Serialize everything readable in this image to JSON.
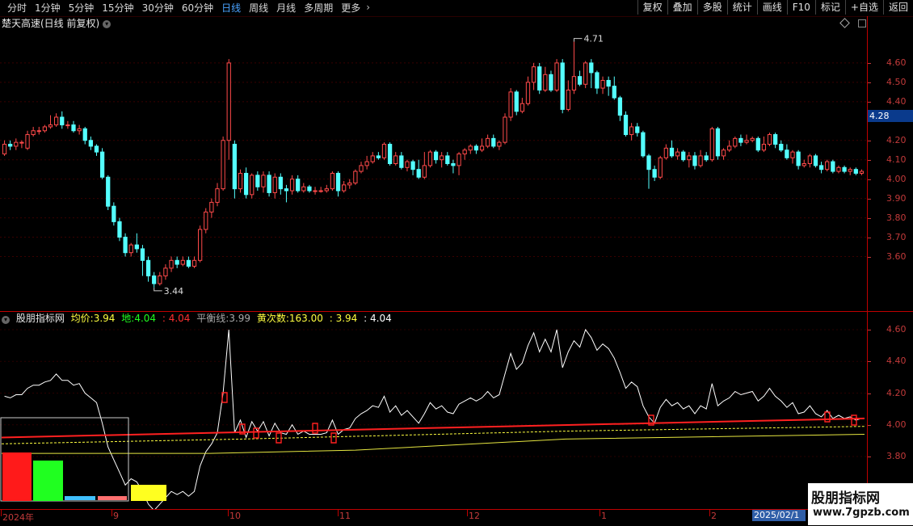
{
  "toolbar": {
    "period_tabs": [
      "分时",
      "1分钟",
      "5分钟",
      "15分钟",
      "30分钟",
      "60分钟",
      "日线",
      "周线",
      "月线",
      "多周期",
      "更多"
    ],
    "active_tab": "日线",
    "right_tools": [
      "复权",
      "叠加",
      "多股",
      "统计",
      "画线",
      "F10",
      "标记",
      "+自选",
      "返回"
    ]
  },
  "main_chart": {
    "title": "楚天高速(日线 前复权)",
    "price_axis": [
      "4.60",
      "4.50",
      "4.40",
      "4.20",
      "4.10",
      "4.00",
      "3.90",
      "3.80",
      "3.70",
      "3.60"
    ],
    "current_price": "4.28",
    "high_marker": "4.71",
    "low_marker": "3.44",
    "colors": {
      "up": "#ff4a4a",
      "down": "#54ffff",
      "axis": "#c23a3a"
    },
    "candles": [
      [
        4.13,
        4.18,
        4.2,
        4.12
      ],
      [
        4.18,
        4.17,
        4.2,
        4.15
      ],
      [
        4.17,
        4.19,
        4.21,
        4.15
      ],
      [
        4.19,
        4.19,
        4.2,
        4.16
      ],
      [
        4.16,
        4.23,
        4.25,
        4.15
      ],
      [
        4.23,
        4.25,
        4.27,
        4.22
      ],
      [
        4.25,
        4.25,
        4.27,
        4.23
      ],
      [
        4.25,
        4.27,
        4.28,
        4.24
      ],
      [
        4.27,
        4.28,
        4.33,
        4.26
      ],
      [
        4.28,
        4.32,
        4.34,
        4.27
      ],
      [
        4.32,
        4.28,
        4.35,
        4.26
      ],
      [
        4.28,
        4.28,
        4.3,
        4.26
      ],
      [
        4.28,
        4.25,
        4.3,
        4.24
      ],
      [
        4.25,
        4.26,
        4.28,
        4.23
      ],
      [
        4.26,
        4.2,
        4.27,
        4.18
      ],
      [
        4.2,
        4.17,
        4.22,
        4.15
      ],
      [
        4.17,
        4.14,
        4.18,
        4.12
      ],
      [
        4.14,
        4.01,
        4.16,
        4.0
      ],
      [
        4.01,
        3.86,
        4.02,
        3.84
      ],
      [
        3.86,
        3.78,
        3.88,
        3.76
      ],
      [
        3.78,
        3.7,
        3.8,
        3.68
      ],
      [
        3.7,
        3.62,
        3.72,
        3.6
      ],
      [
        3.62,
        3.66,
        3.67,
        3.6
      ],
      [
        3.66,
        3.64,
        3.72,
        3.62
      ],
      [
        3.64,
        3.58,
        3.66,
        3.5
      ],
      [
        3.58,
        3.5,
        3.6,
        3.47
      ],
      [
        3.5,
        3.46,
        3.52,
        3.44
      ],
      [
        3.46,
        3.5,
        3.52,
        3.45
      ],
      [
        3.5,
        3.54,
        3.56,
        3.48
      ],
      [
        3.54,
        3.58,
        3.6,
        3.52
      ],
      [
        3.58,
        3.56,
        3.6,
        3.54
      ],
      [
        3.56,
        3.58,
        3.6,
        3.55
      ],
      [
        3.58,
        3.55,
        3.6,
        3.54
      ],
      [
        3.55,
        3.58,
        3.6,
        3.54
      ],
      [
        3.58,
        3.74,
        3.76,
        3.57
      ],
      [
        3.74,
        3.83,
        3.85,
        3.72
      ],
      [
        3.83,
        3.88,
        3.9,
        3.8
      ],
      [
        3.88,
        3.95,
        3.98,
        3.86
      ],
      [
        3.95,
        4.2,
        4.22,
        3.94
      ],
      [
        4.2,
        4.6,
        4.62,
        4.1
      ],
      [
        4.18,
        3.95,
        4.2,
        3.9
      ],
      [
        3.95,
        4.03,
        4.05,
        3.93
      ],
      [
        4.03,
        3.92,
        4.06,
        3.9
      ],
      [
        3.92,
        4.02,
        4.03,
        3.9
      ],
      [
        4.02,
        3.96,
        4.04,
        3.94
      ],
      [
        3.96,
        4.02,
        4.04,
        3.93
      ],
      [
        4.02,
        3.93,
        4.04,
        3.91
      ],
      [
        3.93,
        4.01,
        4.03,
        3.9
      ],
      [
        4.01,
        3.95,
        4.03,
        3.92
      ],
      [
        3.95,
        3.94,
        3.97,
        3.88
      ],
      [
        3.94,
        4.0,
        4.02,
        3.92
      ],
      [
        4.0,
        3.94,
        4.02,
        3.93
      ],
      [
        3.94,
        3.96,
        3.98,
        3.93
      ],
      [
        3.96,
        3.94,
        3.97,
        3.93
      ],
      [
        3.94,
        3.94,
        3.96,
        3.92
      ],
      [
        3.94,
        3.94,
        3.96,
        3.93
      ],
      [
        3.94,
        3.95,
        3.97,
        3.93
      ],
      [
        3.95,
        4.03,
        4.04,
        3.94
      ],
      [
        4.03,
        3.94,
        4.04,
        3.91
      ],
      [
        3.94,
        3.97,
        3.99,
        3.93
      ],
      [
        3.97,
        3.98,
        4.0,
        3.95
      ],
      [
        3.98,
        4.04,
        4.05,
        3.97
      ],
      [
        4.04,
        4.07,
        4.09,
        4.03
      ],
      [
        4.07,
        4.09,
        4.12,
        4.05
      ],
      [
        4.09,
        4.12,
        4.14,
        4.08
      ],
      [
        4.12,
        4.11,
        4.14,
        4.1
      ],
      [
        4.11,
        4.18,
        4.19,
        4.1
      ],
      [
        4.18,
        4.08,
        4.19,
        4.07
      ],
      [
        4.08,
        4.12,
        4.14,
        4.07
      ],
      [
        4.12,
        4.06,
        4.14,
        4.05
      ],
      [
        4.06,
        4.09,
        4.1,
        4.04
      ],
      [
        4.09,
        4.05,
        4.1,
        4.02
      ],
      [
        4.05,
        4.01,
        4.1,
        4.0
      ],
      [
        4.01,
        4.07,
        4.14,
        4.0
      ],
      [
        4.07,
        4.14,
        4.15,
        4.06
      ],
      [
        4.14,
        4.1,
        4.15,
        4.08
      ],
      [
        4.1,
        4.12,
        4.14,
        4.06
      ],
      [
        4.12,
        4.08,
        4.14,
        4.07
      ],
      [
        4.08,
        4.07,
        4.1,
        4.03
      ],
      [
        4.07,
        4.13,
        4.14,
        4.02
      ],
      [
        4.13,
        4.15,
        4.16,
        4.1
      ],
      [
        4.15,
        4.17,
        4.18,
        4.13
      ],
      [
        4.17,
        4.15,
        4.18,
        4.13
      ],
      [
        4.15,
        4.17,
        4.21,
        4.14
      ],
      [
        4.17,
        4.21,
        4.23,
        4.16
      ],
      [
        4.21,
        4.17,
        4.23,
        4.16
      ],
      [
        4.17,
        4.19,
        4.2,
        4.15
      ],
      [
        4.19,
        4.32,
        4.34,
        4.18
      ],
      [
        4.32,
        4.45,
        4.47,
        4.3
      ],
      [
        4.45,
        4.35,
        4.46,
        4.33
      ],
      [
        4.35,
        4.39,
        4.42,
        4.34
      ],
      [
        4.39,
        4.5,
        4.53,
        4.38
      ],
      [
        4.5,
        4.58,
        4.6,
        4.46
      ],
      [
        4.58,
        4.46,
        4.6,
        4.44
      ],
      [
        4.46,
        4.54,
        4.58,
        4.45
      ],
      [
        4.54,
        4.46,
        4.56,
        4.45
      ],
      [
        4.46,
        4.6,
        4.62,
        4.45
      ],
      [
        4.6,
        4.36,
        4.62,
        4.34
      ],
      [
        4.36,
        4.46,
        4.51,
        4.35
      ],
      [
        4.46,
        4.53,
        4.71,
        4.44
      ],
      [
        4.53,
        4.49,
        4.56,
        4.48
      ],
      [
        4.49,
        4.6,
        4.61,
        4.47
      ],
      [
        4.6,
        4.55,
        4.62,
        4.47
      ],
      [
        4.55,
        4.47,
        4.56,
        4.44
      ],
      [
        4.47,
        4.51,
        4.53,
        4.44
      ],
      [
        4.51,
        4.48,
        4.53,
        4.43
      ],
      [
        4.48,
        4.42,
        4.53,
        4.41
      ],
      [
        4.42,
        4.33,
        4.43,
        4.3
      ],
      [
        4.33,
        4.23,
        4.35,
        4.22
      ],
      [
        4.23,
        4.27,
        4.29,
        4.2
      ],
      [
        4.27,
        4.24,
        4.29,
        4.22
      ],
      [
        4.24,
        4.12,
        4.25,
        4.11
      ],
      [
        4.12,
        4.05,
        4.13,
        3.95
      ],
      [
        4.05,
        4.01,
        4.07,
        3.99
      ],
      [
        4.01,
        4.11,
        4.12,
        4.0
      ],
      [
        4.11,
        4.16,
        4.18,
        4.1
      ],
      [
        4.16,
        4.12,
        4.2,
        4.11
      ],
      [
        4.12,
        4.14,
        4.16,
        4.1
      ],
      [
        4.14,
        4.1,
        4.15,
        4.09
      ],
      [
        4.1,
        4.12,
        4.14,
        4.06
      ],
      [
        4.12,
        4.07,
        4.14,
        4.05
      ],
      [
        4.07,
        4.12,
        4.15,
        4.06
      ],
      [
        4.12,
        4.1,
        4.14,
        4.09
      ],
      [
        4.1,
        4.26,
        4.27,
        4.09
      ],
      [
        4.26,
        4.12,
        4.27,
        4.1
      ],
      [
        4.12,
        4.15,
        4.16,
        4.1
      ],
      [
        4.15,
        4.17,
        4.2,
        4.14
      ],
      [
        4.17,
        4.21,
        4.22,
        4.16
      ],
      [
        4.21,
        4.19,
        4.23,
        4.17
      ],
      [
        4.19,
        4.2,
        4.23,
        4.18
      ],
      [
        4.2,
        4.21,
        4.22,
        4.19
      ],
      [
        4.21,
        4.15,
        4.22,
        4.14
      ],
      [
        4.15,
        4.18,
        4.22,
        4.14
      ],
      [
        4.18,
        4.23,
        4.24,
        4.17
      ],
      [
        4.23,
        4.18,
        4.24,
        4.16
      ],
      [
        4.18,
        4.15,
        4.2,
        4.14
      ],
      [
        4.15,
        4.11,
        4.18,
        4.1
      ],
      [
        4.11,
        4.14,
        4.15,
        4.08
      ],
      [
        4.14,
        4.07,
        4.15,
        4.05
      ],
      [
        4.07,
        4.08,
        4.1,
        4.06
      ],
      [
        4.08,
        4.12,
        4.13,
        4.06
      ],
      [
        4.12,
        4.07,
        4.13,
        4.06
      ],
      [
        4.07,
        4.05,
        4.09,
        4.03
      ],
      [
        4.05,
        4.09,
        4.1,
        4.04
      ],
      [
        4.09,
        4.04,
        4.1,
        4.03
      ],
      [
        4.04,
        4.06,
        4.07,
        4.03
      ],
      [
        4.06,
        4.04,
        4.07,
        4.03
      ],
      [
        4.04,
        4.05,
        4.06,
        4.02
      ],
      [
        4.05,
        4.03,
        4.06,
        4.02
      ],
      [
        4.03,
        4.04,
        4.05,
        4.02
      ]
    ]
  },
  "indicator": {
    "name": "股朋指标网",
    "avg_label": "均价:",
    "avg_value": "3.94",
    "ground_label": "地:",
    "ground_value": "4.04",
    "red_value": ": 4.04",
    "balance_label": "平衡线:",
    "balance_value": "3.99",
    "yellow_label": "黄次数:",
    "yellow_value": "163.00",
    "v1": ": 3.94",
    "v2": ": 4.04",
    "axis": [
      "4.60",
      "4.40",
      "4.20",
      "4.00",
      "3.80"
    ],
    "colors": {
      "white": "#ffffff",
      "red": "#ff2020",
      "yellow": "#ffff40",
      "green": "#20ff20",
      "blue": "#40c0ff"
    }
  },
  "time_axis": {
    "labels": [
      "2024年",
      "9",
      "10",
      "11",
      "12",
      "1",
      "2"
    ],
    "date_box": "2025/02/1"
  },
  "watermark": {
    "title": "股朋指标网",
    "url": "www.7gpzb.com"
  }
}
